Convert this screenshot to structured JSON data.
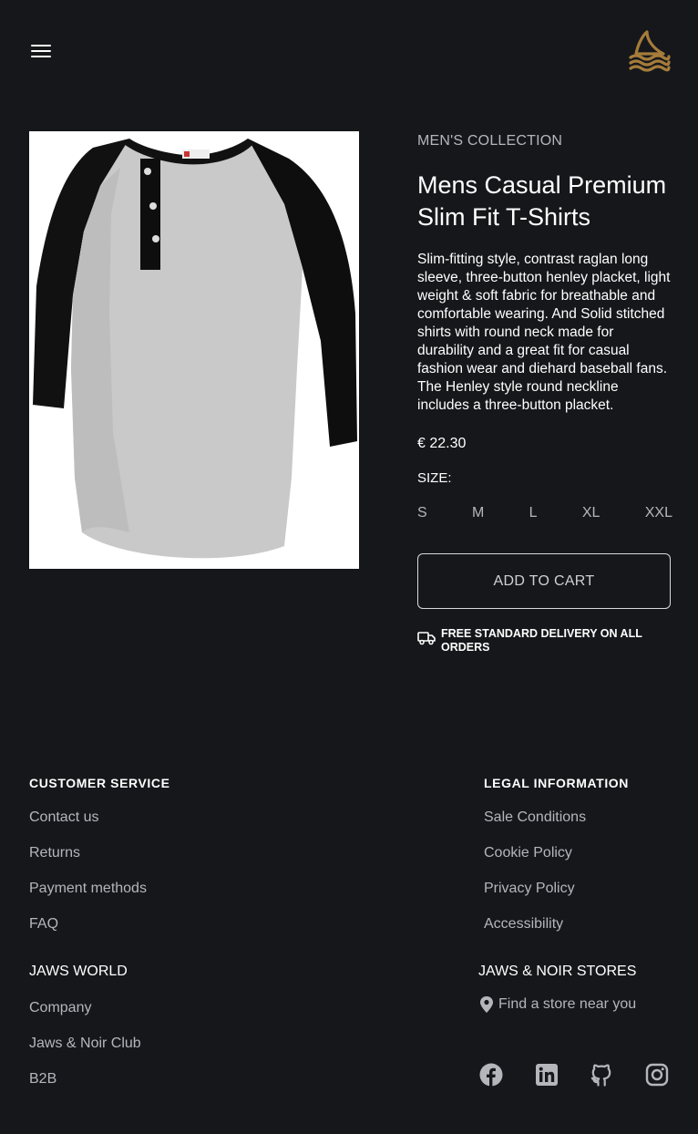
{
  "header": {
    "menu_icon": "hamburger-menu-icon",
    "logo_icon": "shark-fin-waves-logo",
    "accent_color": "#a57c3a"
  },
  "product": {
    "image_alt": "Mens raglan henley t-shirt, grey body with black sleeves",
    "collection": "MEN'S COLLECTION",
    "title": "Mens Casual Premium Slim Fit T-Shirts",
    "description": "Slim-fitting style, contrast raglan long sleeve, three-button henley placket, light weight & soft fabric for breathable and comfortable wearing. And Solid stitched shirts with round neck made for durability and a great fit for casual fashion wear and diehard baseball fans. The Henley style round neckline includes a three-button placket.",
    "price": "€ 22.30",
    "size_label": "SIZE:",
    "sizes": [
      "S",
      "M",
      "L",
      "XL",
      "XXL"
    ],
    "add_to_cart": "ADD TO CART",
    "delivery_icon": "truck-icon",
    "delivery_text": "FREE STANDARD DELIVERY ON ALL ORDERS"
  },
  "footer": {
    "customer_service": {
      "heading": "CUSTOMER SERVICE",
      "links": [
        "Contact us",
        "Returns",
        "Payment methods",
        "FAQ"
      ]
    },
    "legal": {
      "heading": "LEGAL INFORMATION",
      "links": [
        "Sale Conditions",
        "Cookie Policy",
        "Privacy Policy",
        "Accessibility"
      ]
    },
    "jaws_world": {
      "heading": "JAWS WORLD",
      "links": [
        "Company",
        "Jaws & Noir Club",
        "B2B"
      ]
    },
    "stores": {
      "heading": "JAWS & NOIR STORES",
      "find_store": "Find a store near you",
      "find_store_icon": "map-pin-icon"
    },
    "social_icons": [
      "facebook-icon",
      "linkedin-icon",
      "github-icon",
      "instagram-icon"
    ]
  }
}
